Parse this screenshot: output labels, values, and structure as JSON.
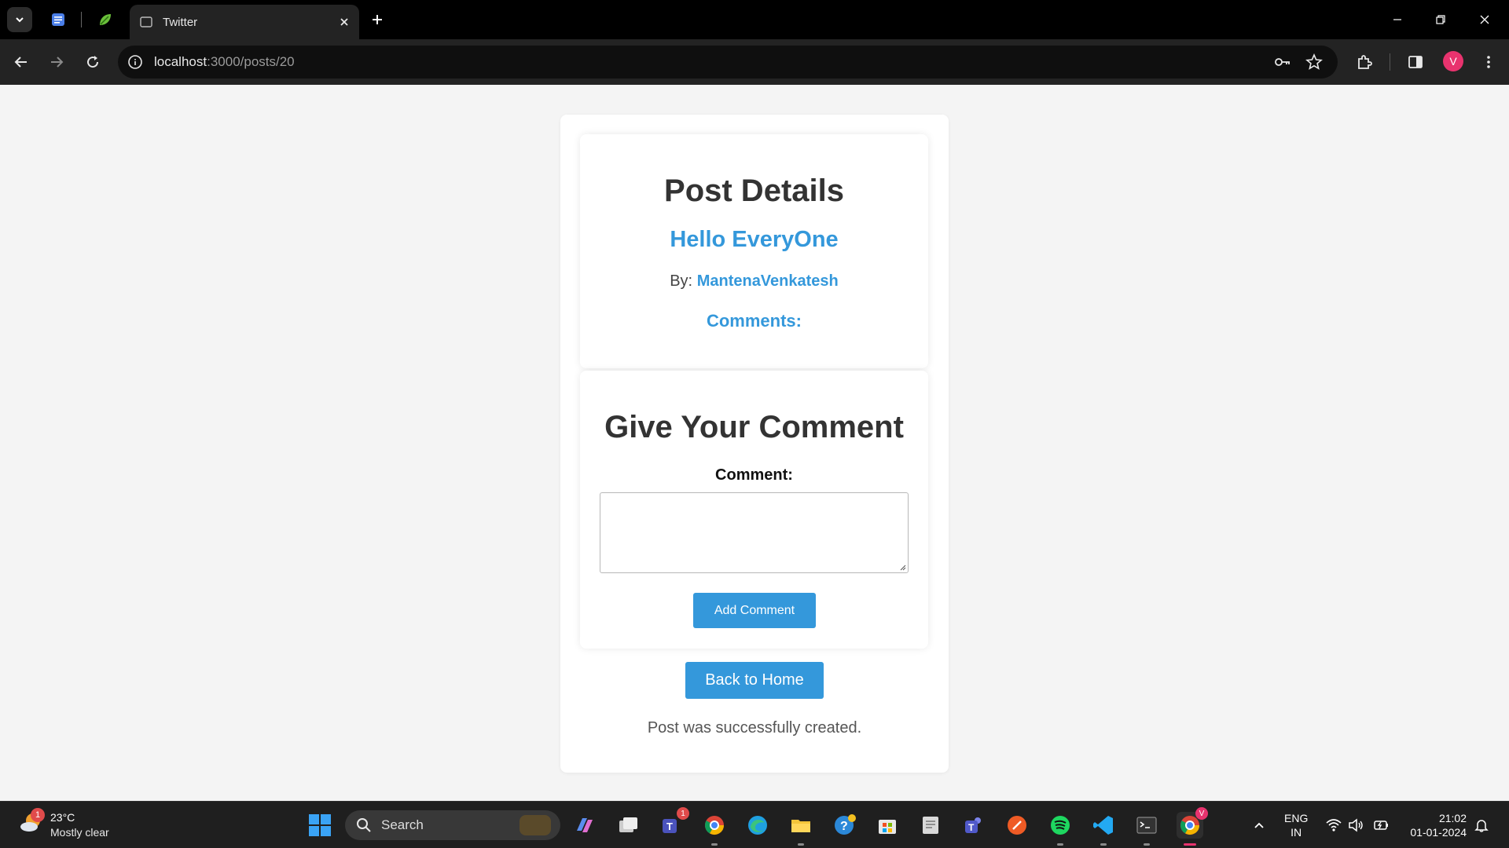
{
  "browser": {
    "tab_title": "Twitter",
    "url_host": "localhost",
    "url_path": ":3000/posts/20",
    "profile_initial": "V"
  },
  "post": {
    "heading": "Post Details",
    "subject": "Hello EveryOne",
    "by_label": "By:",
    "author": "MantenaVenkatesh",
    "comments_label": "Comments:"
  },
  "comment_form": {
    "heading": "Give Your Comment",
    "label": "Comment:",
    "value": "",
    "submit_label": "Add Comment"
  },
  "actions": {
    "back_label": "Back to Home",
    "flash_message": "Post was successfully created."
  },
  "taskbar": {
    "weather_badge": "1",
    "temperature": "23°C",
    "weather_desc": "Mostly clear",
    "search_label": "Search",
    "teams_badge": "1",
    "chrome_badge": "V",
    "language_line1": "ENG",
    "language_line2": "IN",
    "time": "21:02",
    "date": "01-01-2024"
  },
  "colors": {
    "accent": "#3498db",
    "heading": "#333333",
    "page_bg": "#f4f4f4"
  }
}
